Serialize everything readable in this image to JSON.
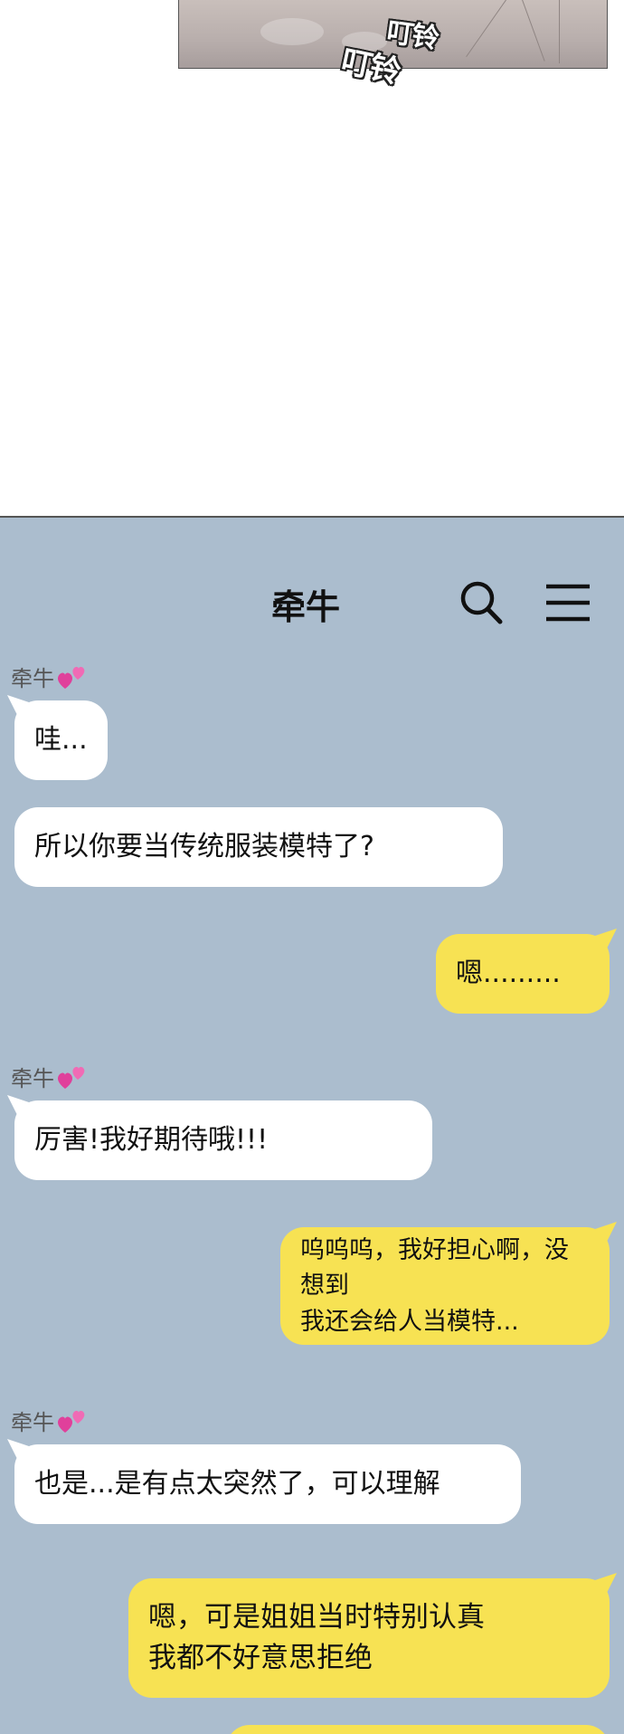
{
  "panel": {
    "sfx_1": "叮铃",
    "sfx_2": "叮铃"
  },
  "chat": {
    "title": "牵牛",
    "icons": [
      "search-icon",
      "menu-icon"
    ],
    "colors": {
      "background": "#abbdce",
      "incoming": "#ffffff",
      "outgoing": "#f7e253"
    },
    "messages": [
      {
        "sender": "牵牛",
        "side": "incoming",
        "text": "哇..."
      },
      {
        "side": "incoming",
        "text": "所以你要当传统服装模特了?"
      },
      {
        "side": "outgoing",
        "text": "嗯........."
      },
      {
        "sender": "牵牛",
        "side": "incoming",
        "text": "厉害!我好期待哦!!!"
      },
      {
        "side": "outgoing",
        "lines": [
          "呜呜呜，我好担心啊，没想到",
          "我还会给人当模特..."
        ]
      },
      {
        "sender": "牵牛",
        "side": "incoming",
        "text": "也是...是有点太突然了，可以理解"
      },
      {
        "side": "outgoing",
        "lines": [
          "嗯，可是姐姐当时特别认真",
          "我都不好意思拒绝"
        ]
      }
    ]
  }
}
